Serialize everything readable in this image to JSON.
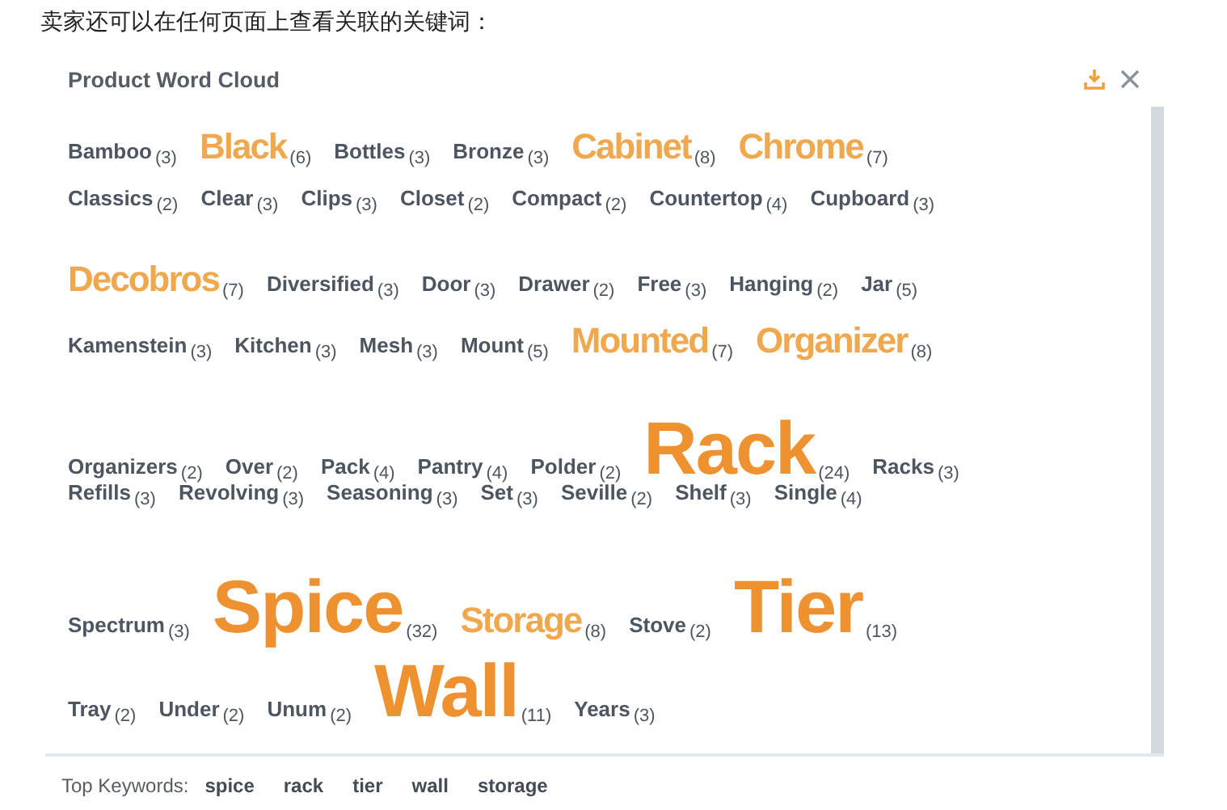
{
  "intro": "卖家还可以在任何页面上查看关联的关键词：",
  "panel": {
    "title": "Product Word Cloud"
  },
  "rows": [
    [
      {
        "word": "Bamboo",
        "count": "(3)",
        "kind": "small"
      },
      {
        "word": "Black",
        "count": "(6)",
        "kind": "medium"
      },
      {
        "word": "Bottles",
        "count": "(3)",
        "kind": "small"
      },
      {
        "word": "Bronze",
        "count": "(3)",
        "kind": "small"
      },
      {
        "word": "Cabinet",
        "count": "(8)",
        "kind": "medium"
      },
      {
        "word": "Chrome",
        "count": "(7)",
        "kind": "medium"
      }
    ],
    [
      {
        "word": "Classics",
        "count": "(2)",
        "kind": "small"
      },
      {
        "word": "Clear",
        "count": "(3)",
        "kind": "small"
      },
      {
        "word": "Clips",
        "count": "(3)",
        "kind": "small"
      },
      {
        "word": "Closet",
        "count": "(2)",
        "kind": "small"
      },
      {
        "word": "Compact",
        "count": "(2)",
        "kind": "small"
      },
      {
        "word": "Countertop",
        "count": "(4)",
        "kind": "small"
      },
      {
        "word": "Cupboard",
        "count": "(3)",
        "kind": "small"
      }
    ],
    [
      {
        "word": "Decobros",
        "count": "(7)",
        "kind": "medium"
      },
      {
        "word": "Diversified",
        "count": "(3)",
        "kind": "small"
      },
      {
        "word": "Door",
        "count": "(3)",
        "kind": "small"
      },
      {
        "word": "Drawer",
        "count": "(2)",
        "kind": "small"
      },
      {
        "word": "Free",
        "count": "(3)",
        "kind": "small"
      },
      {
        "word": "Hanging",
        "count": "(2)",
        "kind": "small"
      },
      {
        "word": "Jar",
        "count": "(5)",
        "kind": "small"
      }
    ],
    [
      {
        "word": "Kamenstein",
        "count": "(3)",
        "kind": "small"
      },
      {
        "word": "Kitchen",
        "count": "(3)",
        "kind": "small"
      },
      {
        "word": "Mesh",
        "count": "(3)",
        "kind": "small"
      },
      {
        "word": "Mount",
        "count": "(5)",
        "kind": "small"
      },
      {
        "word": "Mounted",
        "count": "(7)",
        "kind": "medium"
      },
      {
        "word": "Organizer",
        "count": "(8)",
        "kind": "medium"
      }
    ],
    [
      {
        "word": "Organizers",
        "count": "(2)",
        "kind": "small"
      },
      {
        "word": "Over",
        "count": "(2)",
        "kind": "small"
      },
      {
        "word": "Pack",
        "count": "(4)",
        "kind": "small"
      },
      {
        "word": "Pantry",
        "count": "(4)",
        "kind": "small"
      },
      {
        "word": "Polder",
        "count": "(2)",
        "kind": "small"
      },
      {
        "word": "Rack",
        "count": "(24)",
        "kind": "large"
      },
      {
        "word": "Racks",
        "count": "(3)",
        "kind": "small"
      }
    ],
    [
      {
        "word": "Refills",
        "count": "(3)",
        "kind": "small"
      },
      {
        "word": "Revolving",
        "count": "(3)",
        "kind": "small"
      },
      {
        "word": "Seasoning",
        "count": "(3)",
        "kind": "small"
      },
      {
        "word": "Set",
        "count": "(3)",
        "kind": "small"
      },
      {
        "word": "Seville",
        "count": "(2)",
        "kind": "small"
      },
      {
        "word": "Shelf",
        "count": "(3)",
        "kind": "small"
      },
      {
        "word": "Single",
        "count": "(4)",
        "kind": "small"
      }
    ],
    [
      {
        "word": "Spectrum",
        "count": "(3)",
        "kind": "small"
      },
      {
        "word": "Spice",
        "count": "(32)",
        "kind": "large"
      },
      {
        "word": "Storage",
        "count": "(8)",
        "kind": "medium"
      },
      {
        "word": "Stove",
        "count": "(2)",
        "kind": "small"
      },
      {
        "word": "Tier",
        "count": "(13)",
        "kind": "large"
      }
    ],
    [
      {
        "word": "Tray",
        "count": "(2)",
        "kind": "small"
      },
      {
        "word": "Under",
        "count": "(2)",
        "kind": "small"
      },
      {
        "word": "Unum",
        "count": "(2)",
        "kind": "small"
      },
      {
        "word": "Wall",
        "count": "(11)",
        "kind": "large"
      },
      {
        "word": "Years",
        "count": "(3)",
        "kind": "small"
      }
    ]
  ],
  "top_keywords": {
    "label": "Top Keywords:",
    "items": [
      "spice",
      "rack",
      "tier",
      "wall",
      "storage"
    ]
  }
}
